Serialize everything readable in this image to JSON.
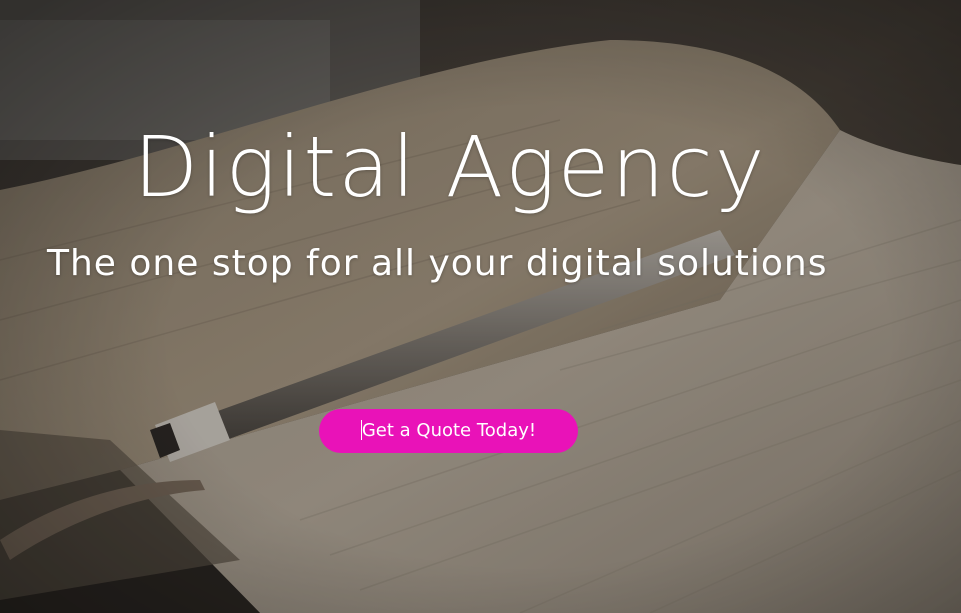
{
  "hero": {
    "headline": "Digital Agency",
    "subheadline": "The one stop for all your digital solutions",
    "cta_label": "Get a Quote Today!"
  },
  "colors": {
    "cta_background": "#e912b8",
    "text": "#ffffff",
    "overlay": "#2a221d"
  },
  "icons": {
    "background": "notebook-and-pen-photo"
  }
}
